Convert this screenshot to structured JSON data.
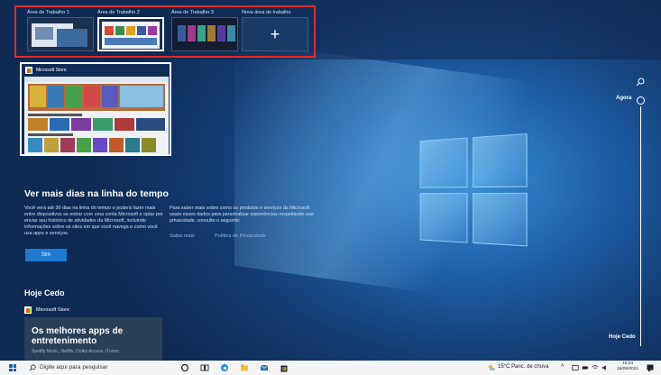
{
  "workspaces": [
    {
      "label": "Área de Trabalho 1",
      "active": false
    },
    {
      "label": "Área de Trabalho 2",
      "active": true
    },
    {
      "label": "Área de Trabalho 3",
      "active": false
    }
  ],
  "new_workspace": {
    "label": "Nova área de trabalho",
    "icon": "+"
  },
  "store_window": {
    "title": "Microsoft Store"
  },
  "timeline": {
    "now_label": "Agora",
    "earliest_label": "Hoje Cedo"
  },
  "info": {
    "title": "Ver mais dias na linha do tempo",
    "left_text": "Você verá até 30 dias na linha do tempo e poderá fazer mais entre dispositivos se entrar com uma conta Microsoft e optar por enviar seu histórico de atividades da Microsoft, incluindo informações sobre os sites em que você navega e como você usa apps e serviços.",
    "right_text": "Para saber mais sobre como os produtos e serviços da Microsoft usam esses dados para personalizar experiências respeitando sua privacidade, consulte o seguinte:",
    "link_more": "Saiba mais",
    "link_privacy": "Política de Privacidade",
    "button": "Sim"
  },
  "section": {
    "title": "Hoje Cedo",
    "app_name": "Microsoft Store",
    "card_title": "Os melhores apps de entretenimento",
    "card_subtitle": "Spotify Music, Netflix, Dolby Access, iTunes,"
  },
  "taskbar": {
    "search_placeholder": "Digite aqui para pesquisar",
    "weather": "15°C  Panc. de chuva",
    "time": "15:24",
    "date": "16/09/2021"
  },
  "colors": {
    "highlight": "#e02a2a",
    "accent": "#1f7ad1"
  }
}
